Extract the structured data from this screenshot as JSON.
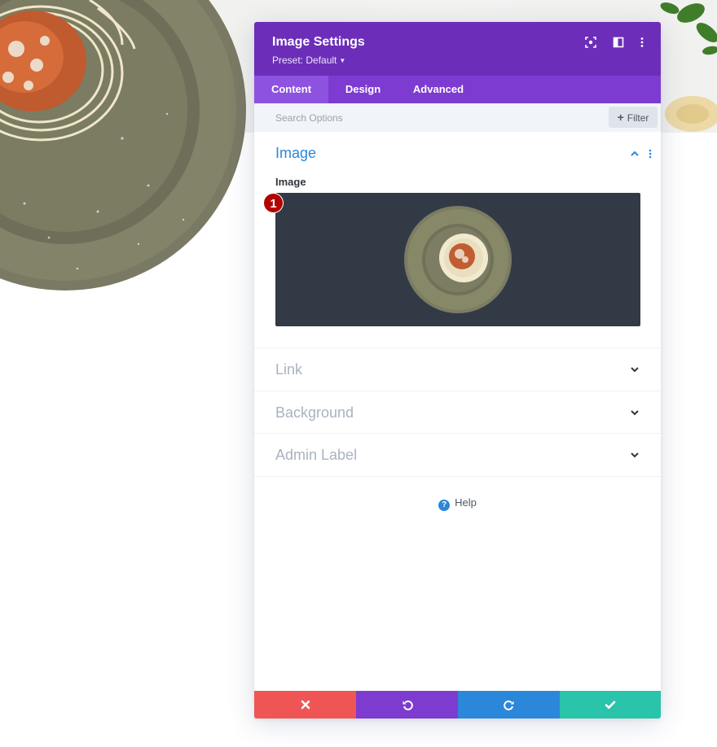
{
  "modal": {
    "title": "Image Settings",
    "preset_label": "Preset: Default",
    "header_icons": [
      "focus-icon",
      "split-view-icon",
      "more-vertical-icon"
    ]
  },
  "tabs": [
    {
      "label": "Content",
      "active": true
    },
    {
      "label": "Design",
      "active": false
    },
    {
      "label": "Advanced",
      "active": false
    }
  ],
  "search": {
    "placeholder": "Search Options",
    "value": ""
  },
  "filter": {
    "label": "Filter"
  },
  "sections": {
    "image": {
      "title": "Image",
      "expanded": true,
      "field_label": "Image",
      "badge": "1"
    },
    "link": {
      "title": "Link",
      "expanded": false
    },
    "background": {
      "title": "Background",
      "expanded": false
    },
    "admin_label": {
      "title": "Admin Label",
      "expanded": false
    }
  },
  "help": {
    "label": "Help"
  },
  "footer": {
    "buttons": [
      {
        "name": "discard",
        "icon": "close-icon",
        "color": "#ef5555"
      },
      {
        "name": "undo",
        "icon": "undo-icon",
        "color": "#7e3bd0"
      },
      {
        "name": "redo",
        "icon": "redo-icon",
        "color": "#2b87da"
      },
      {
        "name": "save",
        "icon": "check-icon",
        "color": "#29c4a9"
      }
    ]
  },
  "colors": {
    "header": "#6c2eb9",
    "tabs": "#7d3bd1",
    "active_tab": "#8e52e0",
    "accent_blue": "#2b87da",
    "image_preview_bg": "#323a46"
  }
}
